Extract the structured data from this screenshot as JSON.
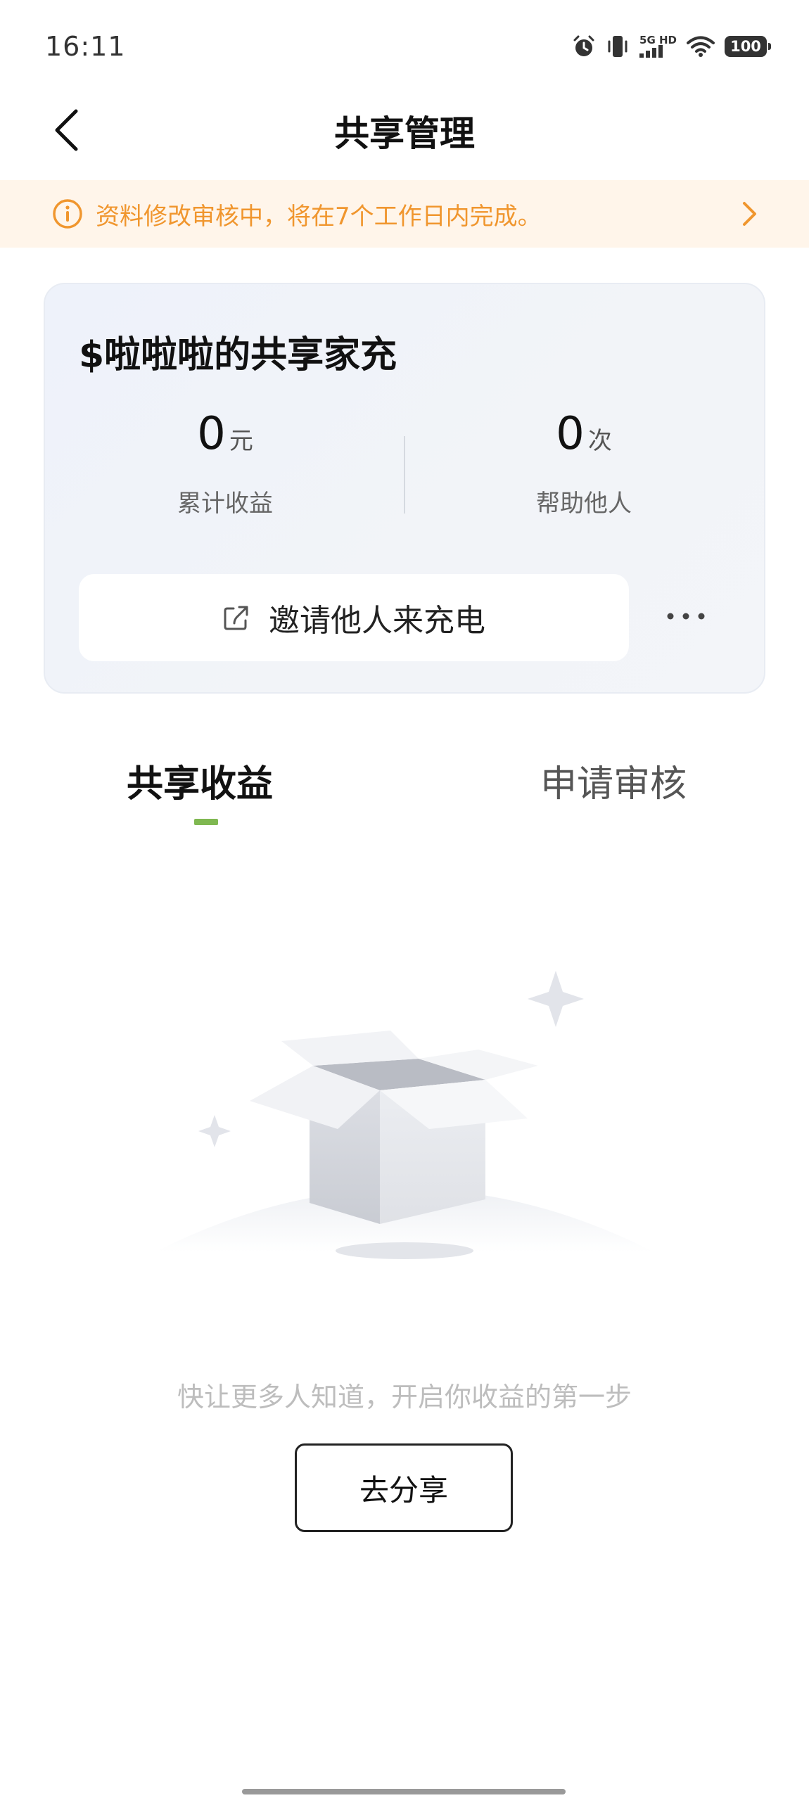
{
  "status_bar": {
    "time": "16:11",
    "network_label_top": "5G HD",
    "battery": "100",
    "icons": [
      "alarm-icon",
      "vibrate-icon",
      "signal-icon",
      "wifi-icon",
      "battery-icon"
    ]
  },
  "header": {
    "title": "共享管理",
    "back_icon": "chevron-left-icon"
  },
  "notice": {
    "text": "资料修改审核中，将在7个工作日内完成。",
    "color": "#f0962e",
    "background": "#fff5ea"
  },
  "card": {
    "title": "$啦啦啦的共享家充",
    "stats": [
      {
        "value": "0",
        "unit": "元",
        "label": "累计收益"
      },
      {
        "value": "0",
        "unit": "次",
        "label": "帮助他人"
      }
    ],
    "invite_label": "邀请他人来充电",
    "more_label": "···"
  },
  "tabs": [
    {
      "label": "共享收益",
      "active": true
    },
    {
      "label": "申请审核",
      "active": false
    }
  ],
  "accent_color": "#7fb851",
  "empty_state": {
    "message": "快让更多人知道，开启你收益的第一步",
    "button_label": "去分享"
  }
}
